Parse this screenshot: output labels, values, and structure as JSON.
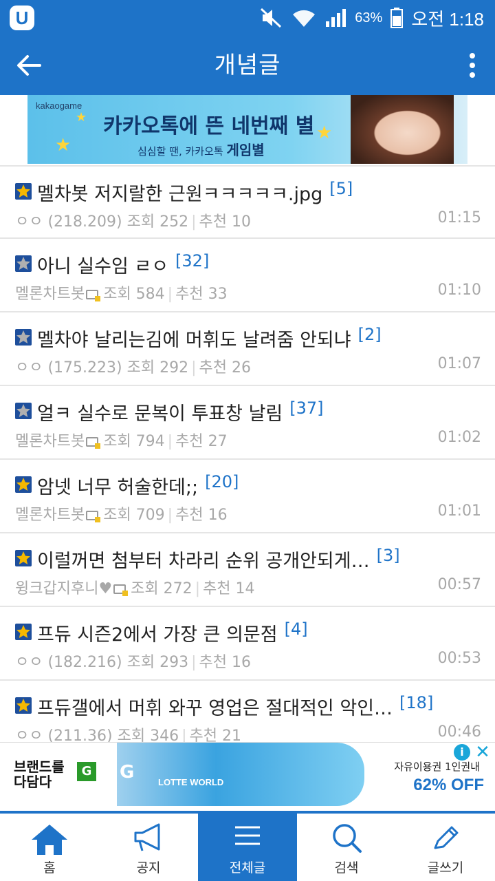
{
  "status_bar": {
    "battery_pct": "63%",
    "time": "오전 1:18",
    "app_logo": "U"
  },
  "app_bar": {
    "title": "개념글"
  },
  "top_banner": {
    "brand": "kakaogame",
    "headline": "카카오톡에 뜬 네번째 별",
    "sub_prefix": "심심할 땐, 카카오톡",
    "sub_bold": "게임별"
  },
  "posts": [
    {
      "title": "멜차봇 저지랄한 근원ㅋㅋㅋㅋㅋ.jpg",
      "count": "[5]",
      "author": "ㅇㅇ (218.209)",
      "views": "조회 252",
      "recommend": "추천 10",
      "time": "01:15",
      "badge_color": "#f5b800",
      "has_member_icon": false
    },
    {
      "title": "아니 실수임 ㄹㅇ",
      "count": "[32]",
      "author": "멜론차트봇",
      "views": "조회 584",
      "recommend": "추천 33",
      "time": "01:10",
      "badge_color": "#b0b0b0",
      "has_member_icon": true
    },
    {
      "title": "멜차야 날리는김에 머휘도 날려줌 안되냐",
      "count": "[2]",
      "author": "ㅇㅇ (175.223)",
      "views": "조회 292",
      "recommend": "추천 26",
      "time": "01:07",
      "badge_color": "#b0b0b0",
      "has_member_icon": false
    },
    {
      "title": "얼ㅋ 실수로 문복이 투표창 날림",
      "count": "[37]",
      "author": "멜론차트봇",
      "views": "조회 794",
      "recommend": "추천 27",
      "time": "01:02",
      "badge_color": "#b0b0b0",
      "has_member_icon": true
    },
    {
      "title": "암넷 너무 허술한데;;",
      "count": "[20]",
      "author": "멜론차트봇",
      "views": "조회 709",
      "recommend": "추천 16",
      "time": "01:01",
      "badge_color": "#f5b800",
      "has_member_icon": true
    },
    {
      "title": "이럴꺼면 첨부터 차라리 순위 공개안되게…",
      "count": "[3]",
      "author": "윙크갑지후니♥",
      "views": "조회 272",
      "recommend": "추천 14",
      "time": "00:57",
      "badge_color": "#f5b800",
      "has_member_icon": true
    },
    {
      "title": "프듀 시즌2에서 가장 큰 의문점",
      "count": "[4]",
      "author": "ㅇㅇ (182.216)",
      "views": "조회 293",
      "recommend": "추천 16",
      "time": "00:53",
      "badge_color": "#f5b800",
      "has_member_icon": false
    },
    {
      "title": "프듀갤에서 머휘 와꾸 영업은 절대적인 악인…",
      "count": "[18]",
      "author": "ㅇㅇ (211.36)",
      "views": "조회 346",
      "recommend": "추천 21",
      "time": "00:46",
      "badge_color": "#f5b800",
      "has_member_icon": false
    }
  ],
  "bottom_ad": {
    "left_text_1": "브랜드를",
    "left_text_2": "다담다",
    "left_g": "G",
    "center_g": "G",
    "center_label": "LOTTE WORLD",
    "right_text": "자유이용권 1인권내",
    "right_discount": "62% OFF",
    "info": "i",
    "close": "✕"
  },
  "nav": {
    "home": "홈",
    "notice": "공지",
    "all": "전체글",
    "search": "검색",
    "write": "글쓰기"
  },
  "colors": {
    "primary": "#1e73c8",
    "count_link": "#1e73c8",
    "meta_gray": "#a8a8a8"
  }
}
